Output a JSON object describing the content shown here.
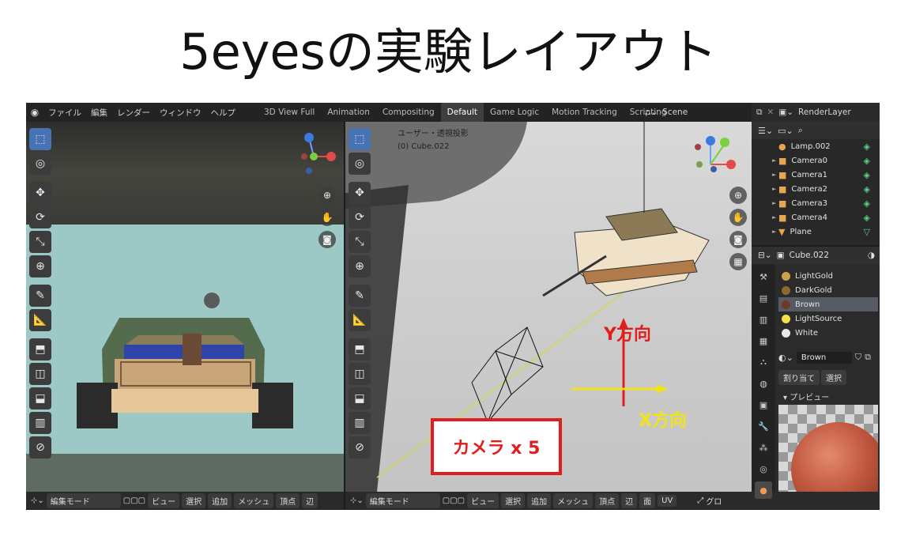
{
  "slide": {
    "title": "5eyesの実験レイアウト"
  },
  "topbar": {
    "menus": [
      "ファイル",
      "編集",
      "レンダー",
      "ウィンドウ",
      "ヘルプ"
    ],
    "workspaces": [
      "3D View Full",
      "Animation",
      "Compositing",
      "Default",
      "Game Logic",
      "Motion Tracking",
      "Scripting"
    ],
    "active_workspace": "Default",
    "scene": "Scene",
    "render_layer": "RenderLayer"
  },
  "viewport_main": {
    "view_name": "ユーザー・透視投影",
    "object_name": "(0) Cube.022"
  },
  "bottombar": {
    "mode": "編集モード",
    "buttons_left": [
      "ビュー",
      "選択",
      "追加",
      "メッシュ",
      "頂点",
      "辺"
    ],
    "buttons_main": [
      "ビュー",
      "選択",
      "追加",
      "メッシュ",
      "頂点",
      "辺",
      "面",
      "UV"
    ],
    "global": "グロ"
  },
  "outliner": {
    "items": [
      {
        "label": "Lamp.002",
        "icon": "lamp-icon"
      },
      {
        "label": "Camera0",
        "icon": "camera-icon"
      },
      {
        "label": "Camera1",
        "icon": "camera-icon"
      },
      {
        "label": "Camera2",
        "icon": "camera-icon"
      },
      {
        "label": "Camera3",
        "icon": "camera-icon"
      },
      {
        "label": "Camera4",
        "icon": "camera-icon"
      },
      {
        "label": "Plane",
        "icon": "mesh-icon"
      }
    ]
  },
  "properties": {
    "object": "Cube.022",
    "materials": [
      {
        "label": "LightGold",
        "color": "#c9a24c"
      },
      {
        "label": "DarkGold",
        "color": "#8a6a2f"
      },
      {
        "label": "Brown",
        "color": "#6b3b2a"
      },
      {
        "label": "LightSource",
        "color": "#f4e04a"
      },
      {
        "label": "White",
        "color": "#e8e8e8"
      }
    ],
    "selected_material": "Brown",
    "assign": "割り当て",
    "select": "選択",
    "preview_label": "プレビュー"
  },
  "annotations": {
    "y_label": "Y方向",
    "x_label": "X方向",
    "camera_label": "カメラ x 5"
  },
  "colors": {
    "accent": "#4772b3",
    "annotation_red": "#e01e1e",
    "annotation_yellow": "#f2e21a"
  }
}
